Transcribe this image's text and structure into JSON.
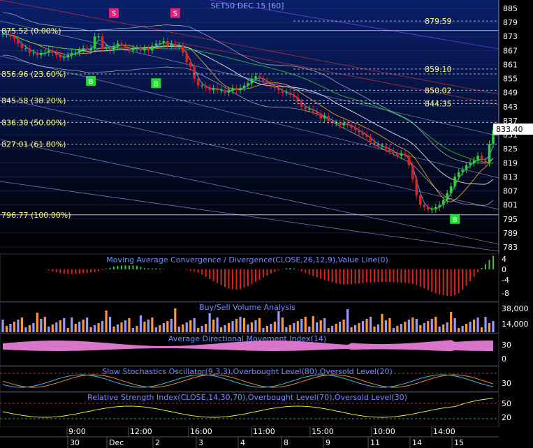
{
  "colors": {
    "bg_top": "#0a1f6a",
    "bg_bottom": "#000000",
    "fib_text": "#ffff66",
    "axis_text": "#ffffff",
    "pane_title": "#6f8fff",
    "candle_up": "#33cc33",
    "candle_down": "#dd2222",
    "price_badge": "#ffffff"
  },
  "chart_data": [
    {
      "type": "line",
      "title": "SET50 DEC 15  [60]",
      "ylim": [
        780,
        888
      ],
      "y_ticks": [
        "885",
        "879",
        "873",
        "867",
        "861",
        "855",
        "849",
        "843",
        "837",
        "831",
        "825",
        "819",
        "813",
        "807",
        "801",
        "795",
        "789",
        "783"
      ],
      "last_price": "833.40",
      "fib_labels": [
        "875.52 (0.00%)",
        "856.96 (23.60%)",
        "845.58 (38.20%)",
        "836.30 (50.00%)",
        "827.01 (61.80%)",
        "796.77 (100.00%)"
      ],
      "fib_values": [
        875.52,
        856.96,
        845.58,
        836.3,
        827.01,
        796.77
      ],
      "right_labels": [
        "879.59",
        "859.10",
        "850.02",
        "844.35"
      ],
      "right_values": [
        879.59,
        859.1,
        850.02,
        844.35
      ],
      "signals": [
        {
          "label": "S",
          "bar": 29,
          "value": 883
        },
        {
          "label": "S",
          "bar": 45,
          "value": 883
        },
        {
          "label": "B",
          "bar": 23,
          "value": 854
        },
        {
          "label": "B",
          "bar": 40,
          "value": 853
        },
        {
          "label": "B",
          "bar": 118,
          "value": 795
        }
      ],
      "series": [
        {
          "name": "candles_close",
          "values": [
            874,
            874,
            873,
            872,
            870,
            868,
            868,
            866,
            866,
            865,
            866,
            866,
            867,
            866,
            865,
            864,
            864,
            865,
            866,
            866,
            867,
            868,
            867,
            868,
            873,
            873,
            868,
            868,
            867,
            869,
            870,
            869,
            868,
            867,
            868,
            868,
            867,
            868,
            867,
            869,
            870,
            870,
            871,
            869,
            870,
            869,
            869,
            866,
            862,
            860,
            855,
            852,
            852,
            851,
            850,
            851,
            850,
            850,
            849,
            850,
            851,
            850,
            851,
            852,
            853,
            855,
            856,
            855,
            854,
            853,
            852,
            851,
            850,
            849,
            849,
            848,
            847,
            845,
            843,
            842,
            842,
            841,
            840,
            838,
            839,
            837,
            836,
            836,
            835,
            836,
            835,
            834,
            833,
            832,
            831,
            830,
            828,
            827,
            826,
            826,
            825,
            824,
            823,
            822,
            823,
            822,
            818,
            812,
            805,
            801,
            800,
            799,
            799,
            800,
            801,
            803,
            806,
            809,
            813,
            815,
            816,
            818,
            819,
            820,
            822,
            820,
            819,
            827,
            833
          ]
        }
      ]
    },
    {
      "type": "bar",
      "title": "Moving Average Convergence / Divergence(CLOSE,26,12,9),Value Line(0)",
      "y_ticks": [
        "4",
        "0",
        "-4",
        "-8"
      ]
    },
    {
      "type": "bar",
      "title": "Buy/Sell Volume Analysis",
      "y_ticks": [
        "38,000",
        "14,000"
      ]
    },
    {
      "type": "area",
      "title": "Average Directional Movement Index(14)",
      "y_ticks": [
        "30",
        "0"
      ]
    },
    {
      "type": "line",
      "title": "Slow Stochastics Oscillator(9,3,3),Overbought Level(80),Oversold Level(20)",
      "y_ticks": [
        "30"
      ]
    },
    {
      "type": "line",
      "title": "Relative Strength Index(CLOSE,14,30,70),Overbought Level(70),Oversold Level(30)",
      "y_ticks": [
        "50",
        "20"
      ]
    }
  ],
  "x_axis": {
    "times": [
      "9:00",
      "12:00",
      "16:00",
      "11:00",
      "15:00",
      "10:00",
      "14:00"
    ],
    "dates": [
      "30",
      "Dec",
      "2",
      "3",
      "4",
      "8",
      "9",
      "11",
      "14",
      "15"
    ]
  }
}
